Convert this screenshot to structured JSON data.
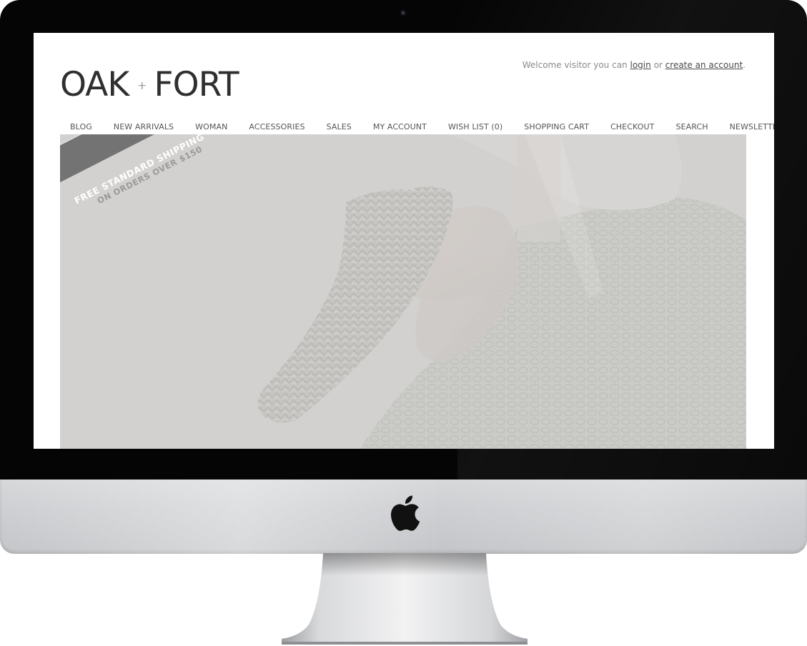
{
  "site": {
    "logo_left": "OAK",
    "logo_plus": "+",
    "logo_right": "FORT"
  },
  "welcome": {
    "prefix": "Welcome visitor you can",
    "login_label": "login",
    "middle": "or",
    "create_account_label": "create an account",
    "suffix": "."
  },
  "nav": {
    "items": [
      {
        "label": "BLOG"
      },
      {
        "label": "NEW ARRIVALS"
      },
      {
        "label": "WOMAN"
      },
      {
        "label": "ACCESSORIES"
      },
      {
        "label": "SALES"
      },
      {
        "label": "MY ACCOUNT"
      },
      {
        "label": "WISH LIST (0)"
      },
      {
        "label": "SHOPPING CART"
      },
      {
        "label": "CHECKOUT"
      },
      {
        "label": "SEARCH"
      },
      {
        "label": "NEWSLETTER"
      }
    ]
  },
  "promo": {
    "line1": "FREE STANDARD SHIPPING",
    "line2": "ON ORDERS OVER $150"
  },
  "colors": {
    "bezel": "#050505",
    "chin": "#cfd0d3",
    "ribbon": "#737373",
    "text": "#555555"
  }
}
